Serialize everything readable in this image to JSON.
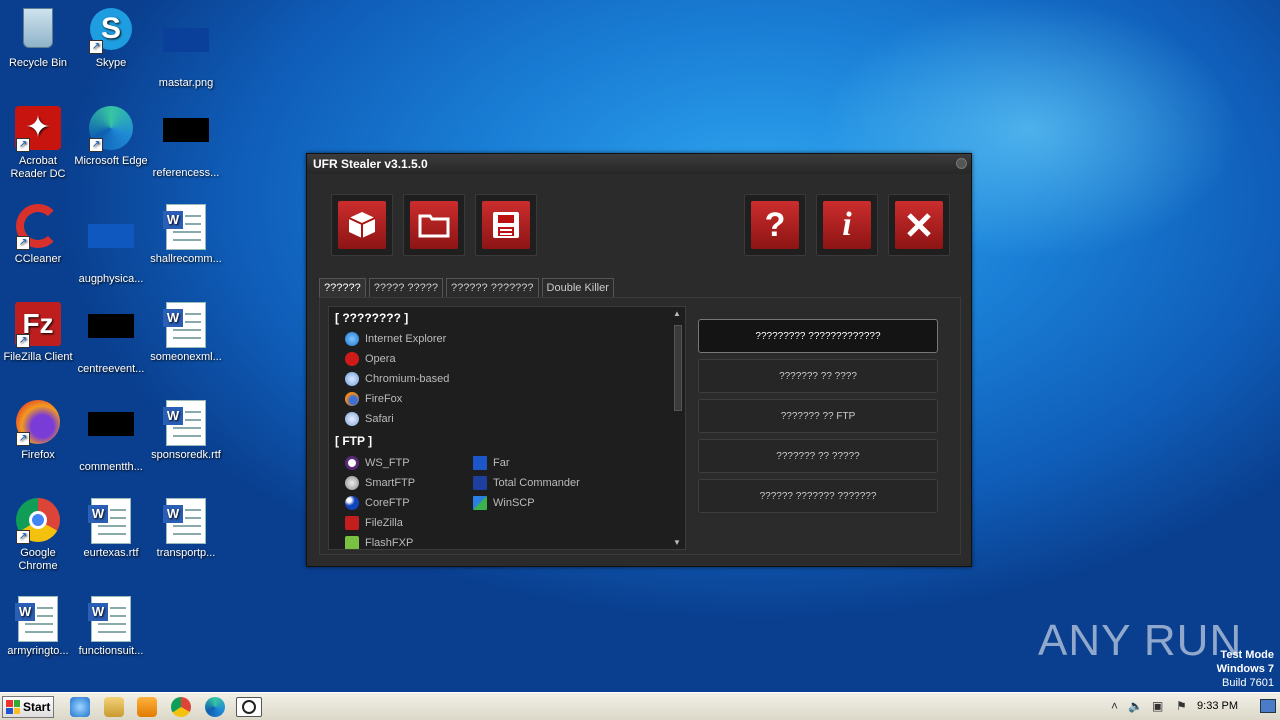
{
  "desktop": {
    "icons": [
      {
        "label": "Recycle Bin"
      },
      {
        "label": "Skype"
      },
      {
        "label": "mastar.png"
      },
      {
        "label": "Acrobat Reader DC"
      },
      {
        "label": "Microsoft Edge"
      },
      {
        "label": "referencess..."
      },
      {
        "label": "CCleaner"
      },
      {
        "label": "augphysica..."
      },
      {
        "label": "shallrecomm..."
      },
      {
        "label": "FileZilla Client"
      },
      {
        "label": "centreevent..."
      },
      {
        "label": "someonexml..."
      },
      {
        "label": "Firefox"
      },
      {
        "label": "commentth..."
      },
      {
        "label": "sponsoredk.rtf"
      },
      {
        "label": "Google Chrome"
      },
      {
        "label": "eurtexas.rtf"
      },
      {
        "label": "transportp..."
      },
      {
        "label": "armyringto..."
      },
      {
        "label": "functionsuit..."
      }
    ]
  },
  "window": {
    "title": "UFR Stealer v3.1.5.0",
    "toolbar": {
      "help_label": "?",
      "info_label": "i"
    },
    "tabs": [
      "??????",
      "????? ?????",
      "?????? ???????",
      "Double Killer"
    ],
    "browsers_header": "[ ???????? ]",
    "browsers": [
      "Internet Explorer",
      "Opera",
      "Chromium-based",
      "FireFox",
      "Safari"
    ],
    "ftp_header": "[ FTP ]",
    "ftp_col1": [
      "WS_FTP",
      "SmartFTP",
      "CoreFTP",
      "FileZilla",
      "FlashFXP"
    ],
    "ftp_col2": [
      "Far",
      "Total Commander",
      "WinSCP"
    ],
    "actions": [
      "????????? ?????????????",
      "??????? ?? ????",
      "??????? ?? FTP",
      "??????? ?? ?????",
      "?????? ??????? ???????"
    ]
  },
  "taskbar": {
    "start_label": "Start",
    "clock": "9:33 PM"
  },
  "watermark": {
    "text": "ANY RUN",
    "line1": "Test Mode",
    "line2": "Windows 7",
    "line3": "Build 7601"
  }
}
